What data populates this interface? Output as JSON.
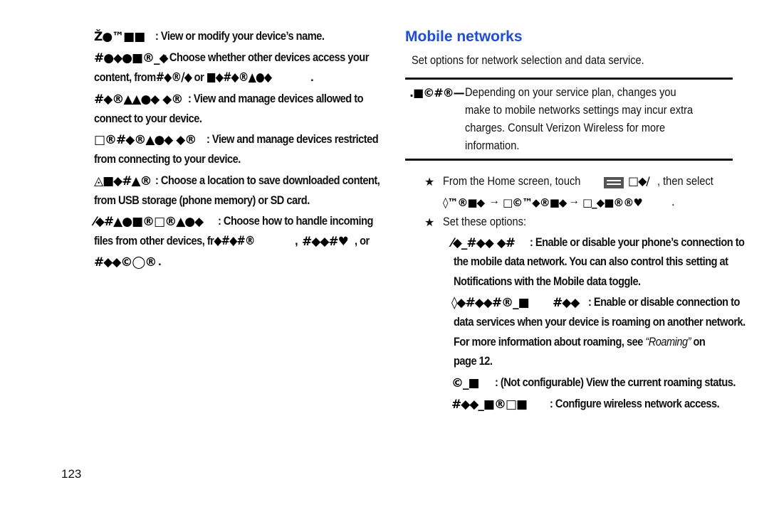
{
  "left_column": {
    "items": [
      {
        "term": "Ž●™■■",
        "line1": ": View or modify your device’s name."
      },
      {
        "term": "#●◆●■®_◆",
        "line1": ": Choose whether other devices access your",
        "line2_prefix": "content, from",
        "line2_glyph_a": "#◆®/◆",
        "line2_mid": " or ",
        "line2_glyph_b": "■◆#◆®▲●◆",
        "line2_end": "."
      },
      {
        "term": "#◆®▲▲●◆ ◆®",
        "line1": ": View and manage devices allowed to",
        "line2": "connect to your device."
      },
      {
        "term": "□®#◆®▲●◆ ◆®",
        "line1": ": View and manage devices restricted",
        "line2": "from connecting to your device."
      },
      {
        "term": "◬■◆#▲®",
        "line1": ": Choose a location to save downloaded content,",
        "line2": "from USB storage (phone memory) or SD card."
      },
      {
        "term": "⁄◆#▲●■®□®▲●◆",
        "line1": ": Choose how to handle incoming",
        "line2_prefix": "files from other devices, fr",
        "line2_glyph_a": "◆#◆#®",
        "line2_glyph_b": "#◆◆#♥",
        "line2_mid": ", ",
        "line2_end": ", or",
        "line3_glyph": "#◆◆©◯®",
        "line3_end": "."
      }
    ]
  },
  "right_column": {
    "title": "Mobile networks",
    "intro": "Set options for network selection and data service.",
    "note": {
      "label": ".■©#®—",
      "lines": [
        "Depending on your service plan, changes you",
        "make to mobile networks settings may incur extra",
        "charges. Consult Verizon Wireless for more",
        "information."
      ]
    },
    "steps": [
      {
        "bullet": "★",
        "text_a": "From the Home screen, touch",
        "icon_glyph": "□◆/",
        "text_b": ", then select",
        "path": [
          "◊™®■◆",
          "□©™◆®■◆",
          "□_◆■®®♥"
        ],
        "arrow": "→",
        "path_end": "."
      },
      {
        "bullet": "★",
        "text": "Set these options:"
      }
    ],
    "options": [
      {
        "term": "⁄◆_#◆◆ ◆#",
        "line1": ": Enable or disable your phone’s connection to",
        "line2": "the mobile data network. You can also control this setting at",
        "line3": "Notifications with the Mobile data toggle."
      },
      {
        "term": "◊◆#◆◆#®_■",
        "term2": "#◆◆",
        "line1": ": Enable or disable connection to",
        "line2": "data services when your device is roaming on another network.",
        "line3_a": "For more information about roaming, see ",
        "line3_italic": "“Roaming”",
        "line3_b": " on",
        "line4": "page 12."
      },
      {
        "term": "©_■",
        "line1": ": (Not configurable) View the current roaming status."
      },
      {
        "term": "#◆◆_■®□■",
        "line1": ": Configure wireless network access."
      }
    ]
  },
  "footer": {
    "page_number": "123"
  }
}
